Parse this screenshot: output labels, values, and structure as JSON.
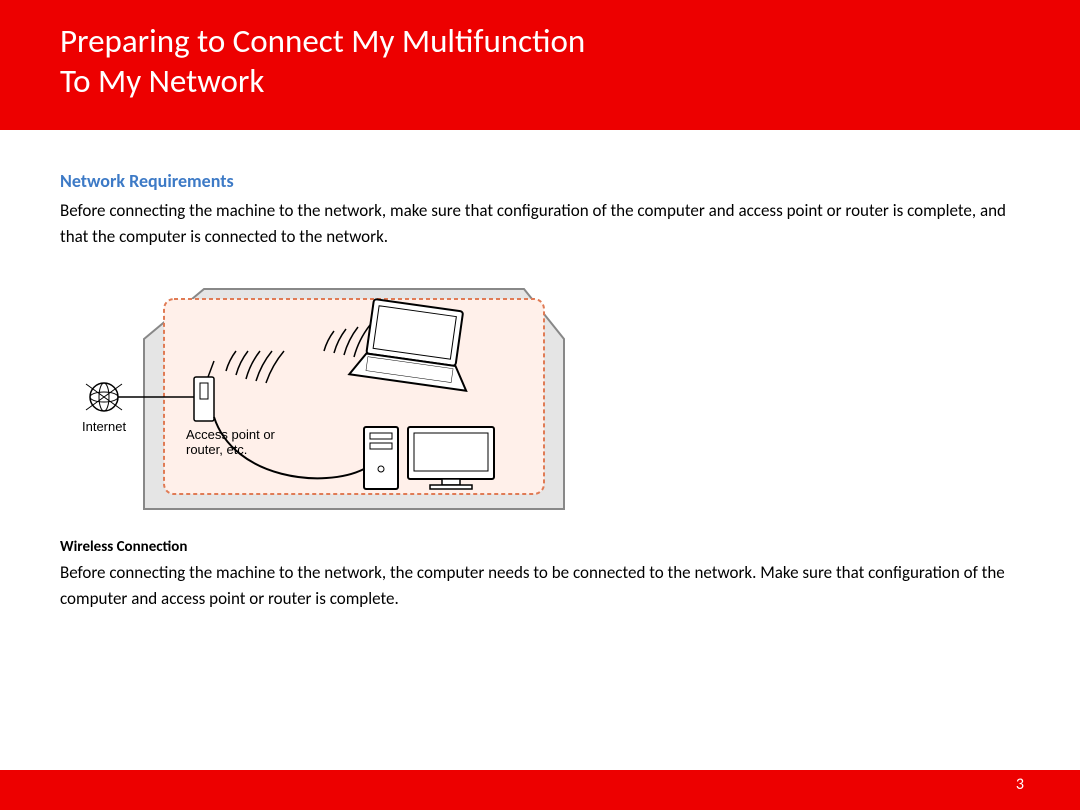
{
  "header": {
    "title_line1": "Preparing to Connect My Multifunction",
    "title_line2": "To My Network"
  },
  "section": {
    "heading": "Network Requirements",
    "body": "Before connecting the machine to the network, make sure that configuration of the computer and access point or router is complete, and that the computer is connected to the network."
  },
  "diagram": {
    "internet_label": "Internet",
    "router_label_line1": "Access point or",
    "router_label_line2": "router, etc."
  },
  "wireless": {
    "heading": "Wireless Connection",
    "body": "Before connecting the machine to the network, the computer needs to be connected to the network. Make sure that configuration of the computer and access point or router is complete."
  },
  "page_number": "3"
}
